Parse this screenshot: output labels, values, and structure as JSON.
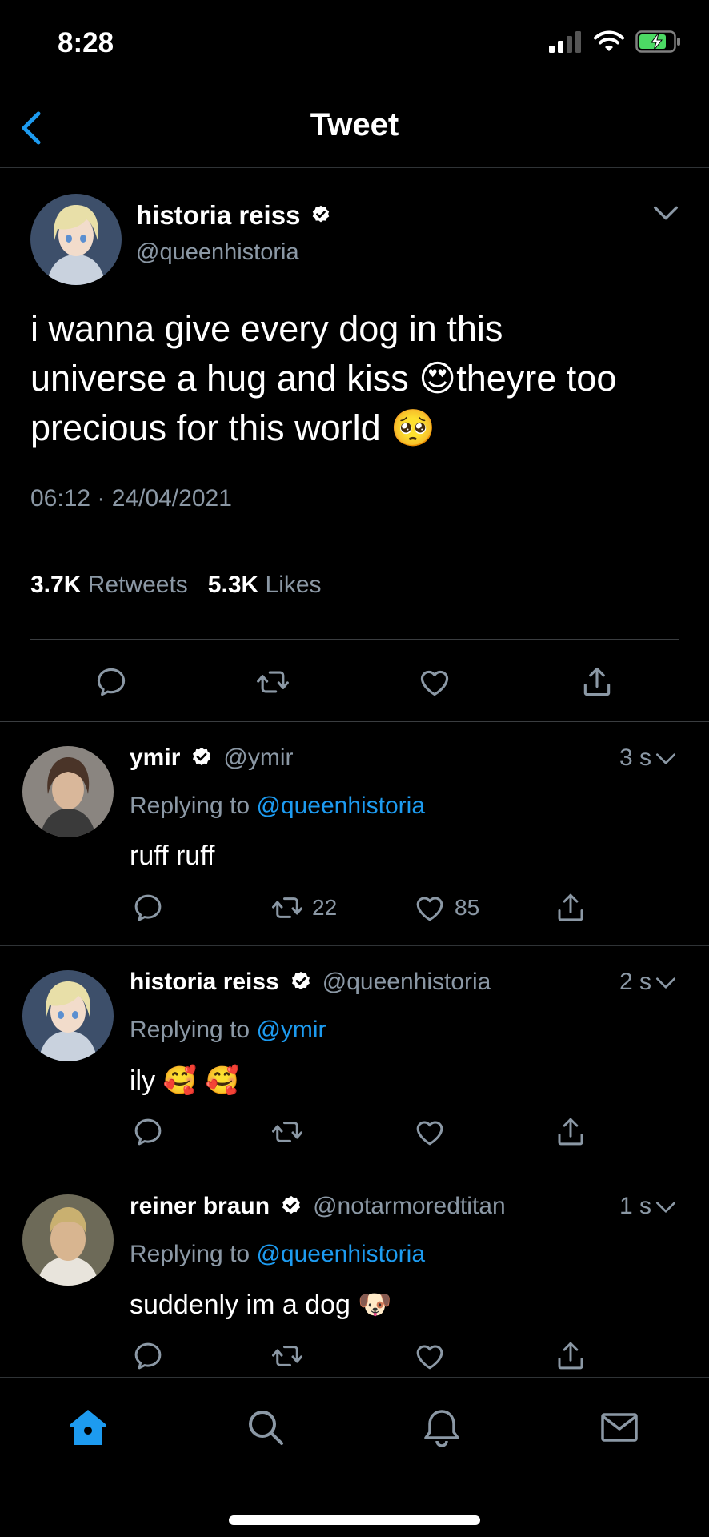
{
  "status_bar": {
    "time": "8:28"
  },
  "nav": {
    "title": "Tweet"
  },
  "main_tweet": {
    "author_name": "historia reiss",
    "handle": "@queenhistoria",
    "text_line1": "i wanna give every dog in this",
    "text_line2_a": "universe a hug and kiss ",
    "emoji_1": "😍",
    "text_line2_b": "theyre too",
    "text_line3": "precious for this world ",
    "emoji_2": "🥺",
    "timestamp": "06:12 · 24/04/2021",
    "retweets_count": "3.7K",
    "retweets_label": "Retweets",
    "likes_count": "5.3K",
    "likes_label": "Likes"
  },
  "replies": [
    {
      "name": "ymir",
      "handle": "@ymir",
      "time": "3 s",
      "replying_prefix": "Replying to",
      "replying_to": "@queenhistoria",
      "text": "ruff ruff",
      "retweets": "22",
      "likes": "85"
    },
    {
      "name": "historia reiss",
      "handle": "@queenhistoria",
      "time": "2 s",
      "replying_prefix": "Replying to",
      "replying_to": "@ymir",
      "text": "ily ",
      "emoji": "🥰 🥰",
      "retweets": "",
      "likes": ""
    },
    {
      "name": "reiner braun",
      "handle": "@notarmoredtitan",
      "time": "1 s",
      "replying_prefix": "Replying to",
      "replying_to": "@queenhistoria",
      "text": "suddenly im a dog ",
      "emoji": "🐶",
      "retweets": "",
      "likes": ""
    }
  ],
  "colors": {
    "background": "#000000",
    "accent": "#1d9bf0",
    "secondary_text": "#8b98a5",
    "divider": "#2f3336",
    "battery": "#4cd964"
  },
  "icons": [
    "back-arrow-icon",
    "signal-icon",
    "wifi-icon",
    "battery-icon",
    "verified-badge-icon",
    "chevron-down-icon",
    "reply-icon",
    "retweet-icon",
    "like-icon",
    "share-icon",
    "home-icon",
    "search-icon",
    "notifications-icon",
    "messages-icon"
  ]
}
